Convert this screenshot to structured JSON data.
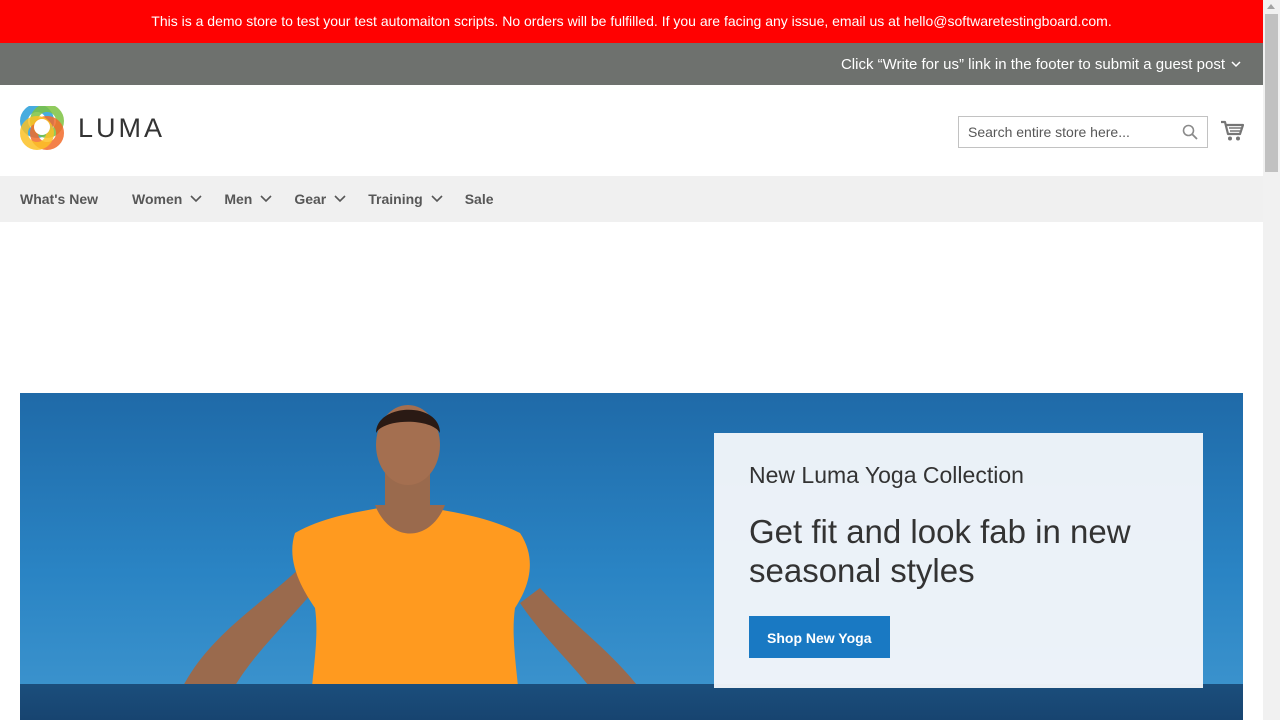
{
  "demo_banner": {
    "text": "This is a demo store to test your test automaiton scripts. No orders will be fulfilled. If you are facing any issue, email us at hello@softwaretestingboard.com."
  },
  "promo_bar": {
    "text": "Click “Write for us” link in the footer to submit a guest post"
  },
  "header": {
    "logo_text": "LUMA",
    "search": {
      "placeholder": "Search entire store here..."
    }
  },
  "nav": {
    "items": [
      {
        "label": "What's New"
      },
      {
        "label": "Women"
      },
      {
        "label": "Men"
      },
      {
        "label": "Gear"
      },
      {
        "label": "Training"
      },
      {
        "label": "Sale"
      }
    ]
  },
  "hero": {
    "eyebrow": "New Luma Yoga Collection",
    "headline": "Get fit and look fab in new seasonal styles",
    "cta_label": "Shop New Yoga"
  },
  "icons": {
    "search": "search-icon",
    "cart": "cart-icon",
    "chevron": "chevron-down-icon"
  },
  "colors": {
    "demo_banner_bg": "#ff0101",
    "promo_bar_bg": "#6e716e",
    "nav_bg": "#f0f0f0",
    "cta_bg": "#1979c3"
  }
}
